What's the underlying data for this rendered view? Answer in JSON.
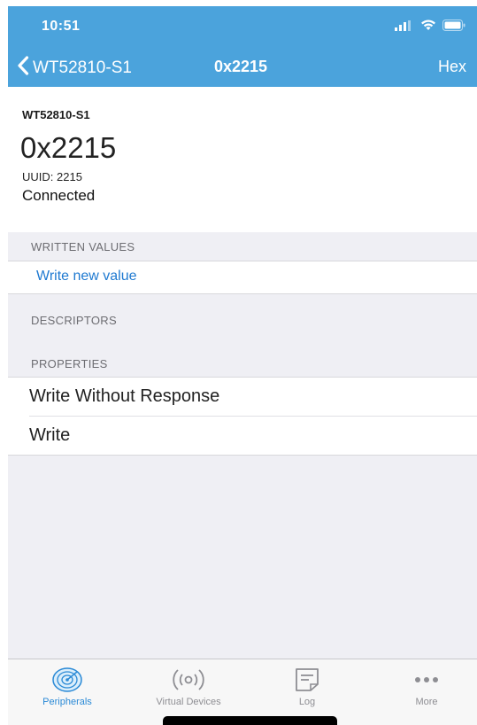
{
  "status_bar": {
    "time": "10:51"
  },
  "nav": {
    "back_label": "WT52810-S1",
    "title": "0x2215",
    "right_label": "Hex"
  },
  "header": {
    "device_name": "WT52810-S1",
    "characteristic": "0x2215",
    "uuid": "UUID: 2215",
    "status": "Connected"
  },
  "sections": {
    "written_values": {
      "title": "WRITTEN VALUES",
      "action": "Write new value"
    },
    "descriptors": {
      "title": "DESCRIPTORS"
    },
    "properties": {
      "title": "PROPERTIES",
      "items": [
        {
          "label": "Write Without Response"
        },
        {
          "label": "Write"
        }
      ]
    }
  },
  "tabs": [
    {
      "label": "Peripherals",
      "icon": "radar-icon",
      "active": true
    },
    {
      "label": "Virtual Devices",
      "icon": "broadcast-icon",
      "active": false
    },
    {
      "label": "Log",
      "icon": "log-icon",
      "active": false
    },
    {
      "label": "More",
      "icon": "more-icon",
      "active": false
    }
  ],
  "colors": {
    "nav_blue": "#4ba3dc",
    "link_blue": "#1f7ad1",
    "active_tab": "#2b8ad6",
    "inactive_tab": "#8e8e93"
  }
}
